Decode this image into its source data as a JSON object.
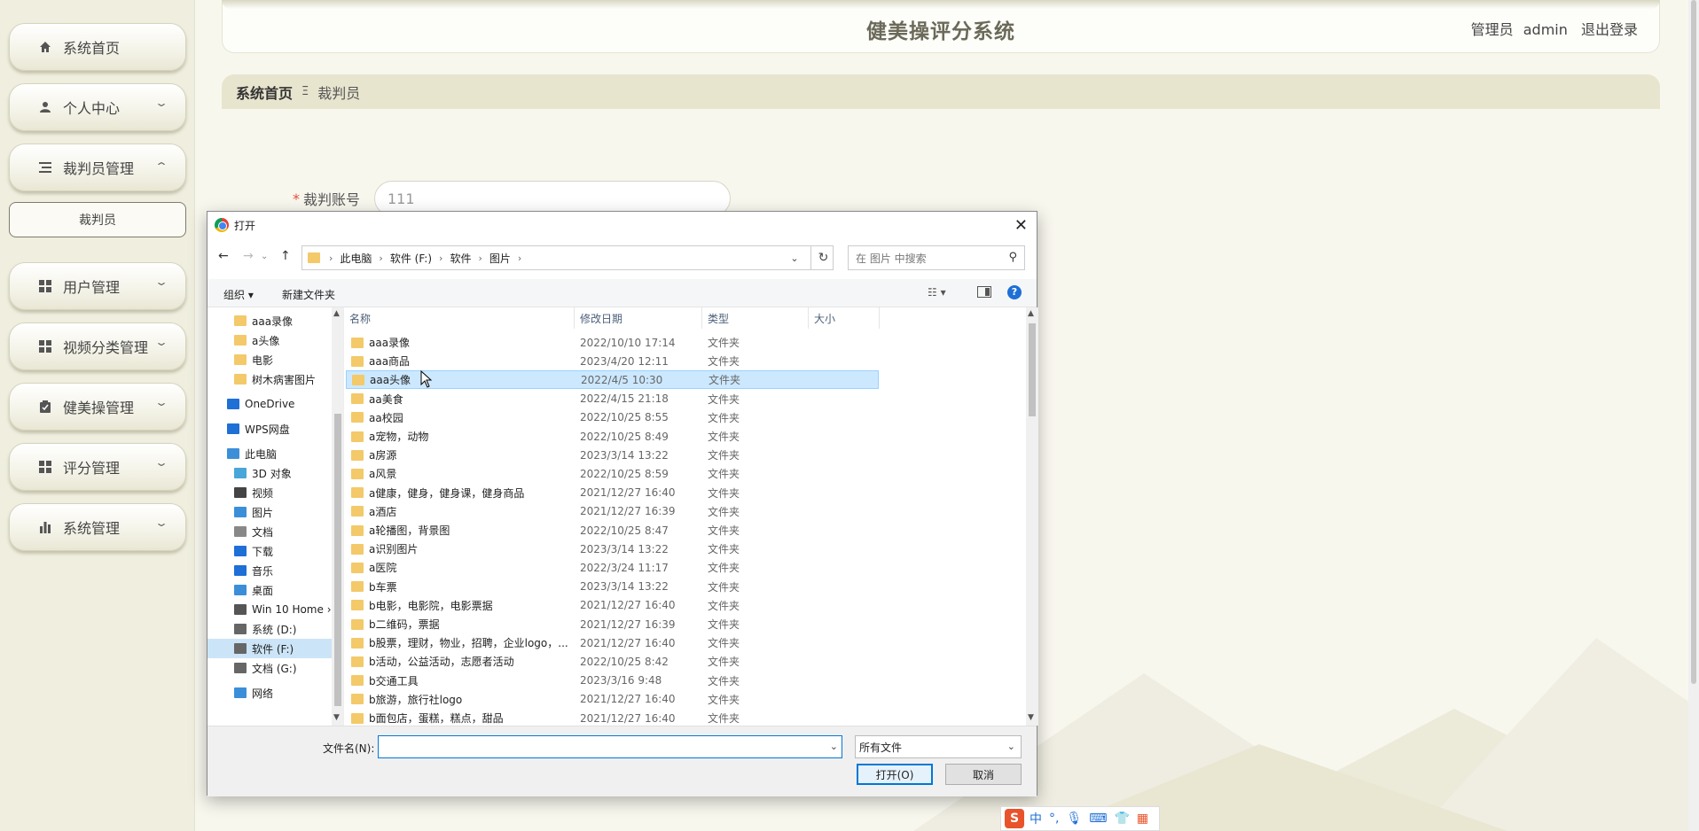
{
  "app": {
    "title": "健美操评分系统",
    "user_role": "管理员",
    "user_name": "admin",
    "logout": "退出登录"
  },
  "sidebar": {
    "items": [
      {
        "label": "系统首页",
        "icon": "home-icon"
      },
      {
        "label": "个人中心",
        "icon": "user-icon"
      },
      {
        "label": "裁判员管理",
        "icon": "list-icon"
      },
      {
        "label": "用户管理",
        "icon": "grid-icon"
      },
      {
        "label": "视频分类管理",
        "icon": "grid-icon"
      },
      {
        "label": "健美操管理",
        "icon": "clipboard-icon"
      },
      {
        "label": "评分管理",
        "icon": "grid-icon"
      },
      {
        "label": "系统管理",
        "icon": "bar-chart-icon"
      }
    ],
    "sub_item": "裁判员"
  },
  "breadcrumb": {
    "home": "系统首页",
    "separator": "Ξ",
    "current": "裁判员"
  },
  "form": {
    "account_label": "裁判账号",
    "account_value": "111"
  },
  "dialog": {
    "title": "打开",
    "address": [
      "此电脑",
      "软件 (F:)",
      "软件",
      "图片"
    ],
    "search_placeholder": "在 图片 中搜索",
    "organize": "组织 ▾",
    "new_folder": "新建文件夹",
    "nav_items": [
      {
        "label": "aaa录像",
        "icon": "folder-icon"
      },
      {
        "label": "a头像",
        "icon": "folder-icon"
      },
      {
        "label": "电影",
        "icon": "folder-icon"
      },
      {
        "label": "树木病害图片",
        "icon": "folder-icon"
      },
      {
        "label": "OneDrive",
        "icon": "cloud-icon"
      },
      {
        "label": "WPS网盘",
        "icon": "cloud-icon"
      },
      {
        "label": "此电脑",
        "icon": "computer-icon"
      },
      {
        "label": "3D 对象",
        "icon": "cube-icon"
      },
      {
        "label": "视频",
        "icon": "video-icon"
      },
      {
        "label": "图片",
        "icon": "picture-icon"
      },
      {
        "label": "文档",
        "icon": "document-icon"
      },
      {
        "label": "下载",
        "icon": "download-icon"
      },
      {
        "label": "音乐",
        "icon": "music-icon"
      },
      {
        "label": "桌面",
        "icon": "desktop-icon"
      },
      {
        "label": "Win 10 Home ›",
        "icon": "network-drive-icon"
      },
      {
        "label": "系统 (D:)",
        "icon": "drive-icon"
      },
      {
        "label": "软件 (F:)",
        "icon": "drive-icon"
      },
      {
        "label": "文档 (G:)",
        "icon": "drive-icon"
      },
      {
        "label": "网络",
        "icon": "network-icon"
      }
    ],
    "columns": {
      "name": "名称",
      "date": "修改日期",
      "type": "类型",
      "size": "大小"
    },
    "files": [
      {
        "name": "aaa录像",
        "date": "2022/10/10 17:14",
        "type": "文件夹"
      },
      {
        "name": "aaa商品",
        "date": "2023/4/20 12:11",
        "type": "文件夹"
      },
      {
        "name": "aaa头像",
        "date": "2022/4/5 10:30",
        "type": "文件夹"
      },
      {
        "name": "aa美食",
        "date": "2022/4/15 21:18",
        "type": "文件夹"
      },
      {
        "name": "aa校园",
        "date": "2022/10/25 8:55",
        "type": "文件夹"
      },
      {
        "name": "a宠物，动物",
        "date": "2022/10/25 8:49",
        "type": "文件夹"
      },
      {
        "name": "a房源",
        "date": "2023/3/14 13:22",
        "type": "文件夹"
      },
      {
        "name": "a风景",
        "date": "2022/10/25 8:59",
        "type": "文件夹"
      },
      {
        "name": "a健康，健身，健身课，健身商品",
        "date": "2021/12/27 16:40",
        "type": "文件夹"
      },
      {
        "name": "a酒店",
        "date": "2021/12/27 16:39",
        "type": "文件夹"
      },
      {
        "name": "a轮播图，背景图",
        "date": "2022/10/25 8:47",
        "type": "文件夹"
      },
      {
        "name": "a识别图片",
        "date": "2023/3/14 13:22",
        "type": "文件夹"
      },
      {
        "name": "a医院",
        "date": "2022/3/24 11:17",
        "type": "文件夹"
      },
      {
        "name": "b车票",
        "date": "2023/3/14 13:22",
        "type": "文件夹"
      },
      {
        "name": "b电影，电影院，电影票据",
        "date": "2021/12/27 16:40",
        "type": "文件夹"
      },
      {
        "name": "b二维码，票据",
        "date": "2021/12/27 16:39",
        "type": "文件夹"
      },
      {
        "name": "b股票，理财，物业，招聘，企业logo，...",
        "date": "2021/12/27 16:40",
        "type": "文件夹"
      },
      {
        "name": "b活动，公益活动，志愿者活动",
        "date": "2022/10/25 8:42",
        "type": "文件夹"
      },
      {
        "name": "b交通工具",
        "date": "2023/3/16 9:48",
        "type": "文件夹"
      },
      {
        "name": "b旅游，旅行社logo",
        "date": "2021/12/27 16:40",
        "type": "文件夹"
      },
      {
        "name": "b面包店，蛋糕，糕点，甜品",
        "date": "2021/12/27 16:40",
        "type": "文件夹"
      }
    ],
    "filename_label": "文件名(N):",
    "filename_value": "",
    "filetype": "所有文件",
    "open_button": "打开(O)",
    "cancel_button": "取消"
  },
  "ime": {
    "mode": "中"
  }
}
